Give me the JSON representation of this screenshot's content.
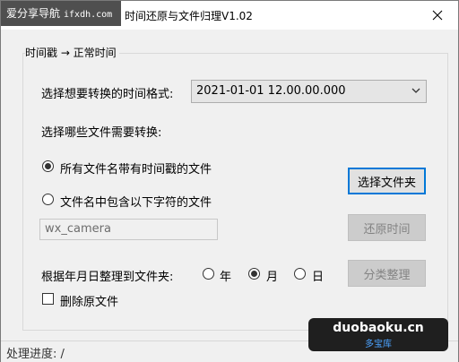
{
  "window": {
    "title": "时间还原与文件归理V1.02",
    "watermark_text": "爱分享导航",
    "watermark_site": "ifxdh.com"
  },
  "group": {
    "title": "时间戳 → 正常时间"
  },
  "format": {
    "label": "选择想要转换的时间格式:",
    "selected": "2021-01-01 12.00.00.000"
  },
  "files": {
    "label": "选择哪些文件需要转换:",
    "option_all": "所有文件名带有时间戳的文件",
    "option_all_checked": true,
    "option_contains": "文件名中包含以下字符的文件",
    "option_contains_checked": false,
    "contains_value": "wx_camera"
  },
  "buttons": {
    "select_folder": "选择文件夹",
    "restore_time": "还原时间",
    "classify": "分类整理"
  },
  "organize": {
    "label": "根据年月日整理到文件夹:",
    "year": "年",
    "month": "月",
    "day": "日",
    "selected": "月",
    "delete_original": "删除原文件",
    "delete_original_checked": false
  },
  "status": {
    "text": "处理进度: /"
  },
  "badge": {
    "main": "duobaoku.cn",
    "sub": "多宝库"
  },
  "colors": {
    "accent": "#0078d7",
    "window_bg": "#f0f0f0",
    "badge_sub": "#4ca3ff"
  }
}
